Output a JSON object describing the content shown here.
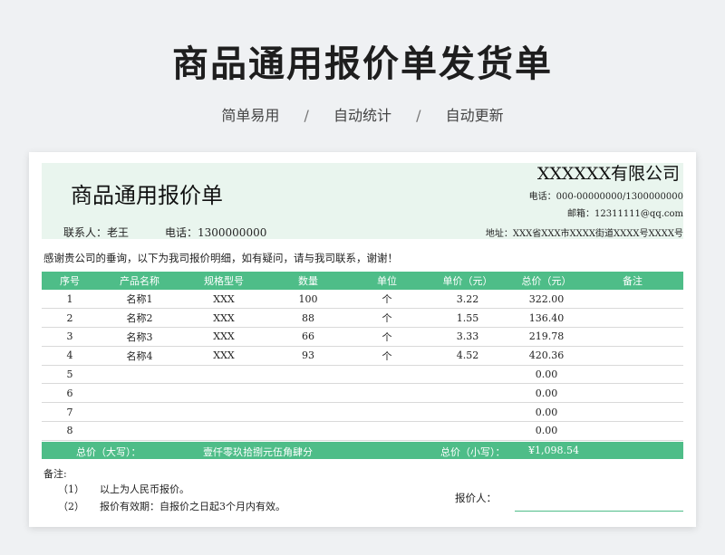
{
  "page": {
    "title": "商品通用报价单发货单",
    "tags": [
      "简单易用",
      "自动统计",
      "自动更新"
    ],
    "separator": "/"
  },
  "sheet": {
    "title": "商品通用报价单",
    "company": "XXXXXX有限公司",
    "phone_line": "电话：000-00000000/1300000000",
    "email_line": "邮箱：12311111@qq.com",
    "contact": "联系人：老王",
    "contact_phone": "电话：1300000000",
    "address": "地址：XXX省XXX市XXXX街道XXXX号XXXX号",
    "thanks": "感谢贵公司的垂询，以下为我司报价明细，如有疑问，请与我司联系，谢谢！"
  },
  "table": {
    "headers": [
      "序号",
      "产品名称",
      "规格型号",
      "数量",
      "单位",
      "单价（元）",
      "总价（元）",
      "备注"
    ],
    "rows": [
      [
        "1",
        "名称1",
        "XXX",
        "100",
        "个",
        "3.22",
        "322.00",
        ""
      ],
      [
        "2",
        "名称2",
        "XXX",
        "88",
        "个",
        "1.55",
        "136.40",
        ""
      ],
      [
        "3",
        "名称3",
        "XXX",
        "66",
        "个",
        "3.33",
        "219.78",
        ""
      ],
      [
        "4",
        "名称4",
        "XXX",
        "93",
        "个",
        "4.52",
        "420.36",
        ""
      ],
      [
        "5",
        "",
        "",
        "",
        "",
        "",
        "0.00",
        ""
      ],
      [
        "6",
        "",
        "",
        "",
        "",
        "",
        "0.00",
        ""
      ],
      [
        "7",
        "",
        "",
        "",
        "",
        "",
        "0.00",
        ""
      ],
      [
        "8",
        "",
        "",
        "",
        "",
        "",
        "0.00",
        ""
      ]
    ]
  },
  "totals": {
    "upper_label": "总价（大写）：",
    "upper_value": "壹仟零玖拾捌元伍角肆分",
    "lower_label": "总价（小写）：",
    "lower_value": "¥1,098.54"
  },
  "notes": {
    "label": "备注:",
    "items": [
      {
        "num": "（1）",
        "text": "以上为人民币报价。"
      },
      {
        "num": "（2）",
        "text": "报价有效期：自报价之日起3个月内有效。"
      }
    ],
    "quoter_label": "报价人："
  },
  "colors": {
    "accent": "#4ebd88",
    "header_band": "#e9f5ee",
    "background": "#eff1f3"
  }
}
